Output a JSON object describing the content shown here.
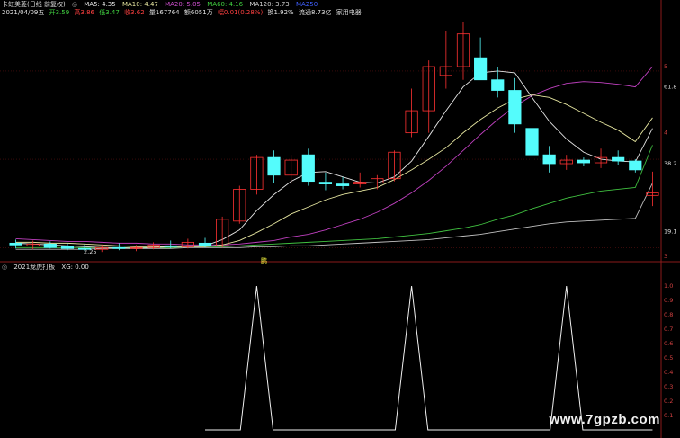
{
  "header": {
    "stock": "卡虹美菱(日线 前复权)",
    "ma5": "MA5: 4.35",
    "ma10": "MA10: 4.47",
    "ma20": "MA20: 5.05",
    "ma60": "MA60: 4.16",
    "ma120": "MA120: 3.73",
    "ma250": "MA250"
  },
  "info": {
    "date": "2021/04/09五",
    "open": "开3.59",
    "high": "高3.86",
    "low": "低3.47",
    "close": "收3.62",
    "volume": "量167764",
    "amount": "额6051万",
    "change": "幅0.01(0.28%)",
    "turnover": "换1.92%",
    "float": "流通8.73亿",
    "sector": "家用电器"
  },
  "indicator": {
    "name": "2021龙虎打板",
    "xg": "XG: 0.00"
  },
  "marker_label": "鹏",
  "low_label": "2.25",
  "price_axis": {
    "labels": [
      "5",
      "61.8",
      "4",
      "38.2",
      "19.1",
      "3"
    ]
  },
  "ind_axis": {
    "labels": [
      "1.0",
      "0.9",
      "0.8",
      "0.7",
      "0.6",
      "0.5",
      "0.4",
      "0.3",
      "0.2",
      "0.1"
    ]
  },
  "watermark": "www.7gpzb.com",
  "colors": {
    "up": "#ff3232",
    "down": "#54fcfc",
    "ma5": "#e6e6e6",
    "ma10": "#e6e6a0",
    "ma20": "#c040c0",
    "ma60": "#40c040",
    "ma120": "#c0c0c0",
    "ma250": "#4040ff"
  },
  "chart_data": {
    "type": "candlestick",
    "candles": [
      {
        "o": 3.05,
        "h": 3.09,
        "l": 2.99,
        "c": 3.03
      },
      {
        "o": 3.02,
        "h": 3.08,
        "l": 2.98,
        "c": 3.04
      },
      {
        "o": 3.04,
        "h": 3.07,
        "l": 2.99,
        "c": 3.0
      },
      {
        "o": 3.01,
        "h": 3.05,
        "l": 2.97,
        "c": 2.99
      },
      {
        "o": 2.99,
        "h": 3.04,
        "l": 2.96,
        "c": 2.98
      },
      {
        "o": 2.98,
        "h": 3.03,
        "l": 2.95,
        "c": 3.0
      },
      {
        "o": 3.0,
        "h": 3.05,
        "l": 2.97,
        "c": 2.99
      },
      {
        "o": 2.99,
        "h": 3.03,
        "l": 2.96,
        "c": 3.0
      },
      {
        "o": 3.0,
        "h": 3.06,
        "l": 2.98,
        "c": 3.03
      },
      {
        "o": 3.02,
        "h": 3.08,
        "l": 2.99,
        "c": 3.01
      },
      {
        "o": 3.01,
        "h": 3.1,
        "l": 2.99,
        "c": 3.06
      },
      {
        "o": 3.05,
        "h": 3.11,
        "l": 3.0,
        "c": 3.02
      },
      {
        "o": 3.02,
        "h": 3.35,
        "l": 3.0,
        "c": 3.32
      },
      {
        "o": 3.3,
        "h": 3.7,
        "l": 3.27,
        "c": 3.66
      },
      {
        "o": 3.66,
        "h": 4.05,
        "l": 3.6,
        "c": 4.02
      },
      {
        "o": 4.02,
        "h": 4.1,
        "l": 3.73,
        "c": 3.82
      },
      {
        "o": 3.82,
        "h": 4.05,
        "l": 3.72,
        "c": 3.99
      },
      {
        "o": 4.05,
        "h": 4.12,
        "l": 3.7,
        "c": 3.75
      },
      {
        "o": 3.74,
        "h": 3.85,
        "l": 3.65,
        "c": 3.72
      },
      {
        "o": 3.72,
        "h": 3.8,
        "l": 3.66,
        "c": 3.7
      },
      {
        "o": 3.72,
        "h": 3.85,
        "l": 3.68,
        "c": 3.74
      },
      {
        "o": 3.73,
        "h": 3.82,
        "l": 3.66,
        "c": 3.78
      },
      {
        "o": 3.78,
        "h": 4.1,
        "l": 3.75,
        "c": 4.08
      },
      {
        "o": 4.3,
        "h": 4.8,
        "l": 4.25,
        "c": 4.55
      },
      {
        "o": 4.55,
        "h": 5.12,
        "l": 4.3,
        "c": 5.05
      },
      {
        "o": 4.95,
        "h": 5.45,
        "l": 4.8,
        "c": 5.05
      },
      {
        "o": 5.05,
        "h": 5.55,
        "l": 4.9,
        "c": 5.42
      },
      {
        "o": 5.15,
        "h": 5.38,
        "l": 4.95,
        "c": 4.9
      },
      {
        "o": 4.9,
        "h": 5.05,
        "l": 4.7,
        "c": 4.78
      },
      {
        "o": 4.78,
        "h": 4.92,
        "l": 4.3,
        "c": 4.4
      },
      {
        "o": 4.35,
        "h": 4.45,
        "l": 4.0,
        "c": 4.05
      },
      {
        "o": 4.05,
        "h": 4.15,
        "l": 3.85,
        "c": 3.95
      },
      {
        "o": 3.95,
        "h": 4.05,
        "l": 3.88,
        "c": 3.99
      },
      {
        "o": 3.99,
        "h": 4.02,
        "l": 3.92,
        "c": 3.96
      },
      {
        "o": 3.96,
        "h": 4.12,
        "l": 3.9,
        "c": 4.02
      },
      {
        "o": 4.02,
        "h": 4.1,
        "l": 3.94,
        "c": 3.98
      },
      {
        "o": 3.98,
        "h": 4.0,
        "l": 3.85,
        "c": 3.88
      },
      {
        "o": 3.59,
        "h": 3.86,
        "l": 3.47,
        "c": 3.62
      }
    ],
    "skip_gaps": [
      31
    ],
    "y_range": [
      2.85,
      5.6
    ],
    "ma5": [
      3.05,
      3.04,
      3.03,
      3.02,
      3.01,
      3.0,
      3.0,
      2.99,
      3.0,
      3.01,
      3.02,
      3.02,
      3.09,
      3.2,
      3.42,
      3.6,
      3.75,
      3.85,
      3.86,
      3.8,
      3.74,
      3.73,
      3.8,
      3.98,
      4.26,
      4.55,
      4.82,
      4.98,
      5.0,
      4.98,
      4.7,
      4.43,
      4.23,
      4.08,
      4.0,
      3.98,
      3.97,
      4.35
    ],
    "ma10": [
      3.06,
      3.06,
      3.05,
      3.05,
      3.04,
      3.03,
      3.02,
      3.01,
      3.01,
      3.01,
      3.01,
      3.01,
      3.03,
      3.08,
      3.17,
      3.27,
      3.38,
      3.46,
      3.54,
      3.6,
      3.64,
      3.68,
      3.77,
      3.88,
      4.0,
      4.13,
      4.3,
      4.45,
      4.58,
      4.68,
      4.73,
      4.7,
      4.62,
      4.52,
      4.42,
      4.33,
      4.2,
      4.47
    ],
    "ma20": [
      3.1,
      3.09,
      3.08,
      3.07,
      3.07,
      3.06,
      3.05,
      3.05,
      3.04,
      3.04,
      3.03,
      3.03,
      3.03,
      3.04,
      3.06,
      3.08,
      3.12,
      3.15,
      3.2,
      3.26,
      3.32,
      3.4,
      3.5,
      3.62,
      3.76,
      3.92,
      4.1,
      4.28,
      4.45,
      4.6,
      4.72,
      4.8,
      4.86,
      4.88,
      4.87,
      4.85,
      4.82,
      5.05
    ],
    "ma60": [
      3.0,
      3.0,
      3.0,
      3.0,
      3.0,
      3.0,
      3.0,
      3.0,
      3.0,
      3.0,
      3.01,
      3.01,
      3.01,
      3.02,
      3.03,
      3.04,
      3.05,
      3.06,
      3.07,
      3.08,
      3.09,
      3.1,
      3.12,
      3.14,
      3.16,
      3.19,
      3.22,
      3.26,
      3.32,
      3.37,
      3.44,
      3.5,
      3.56,
      3.6,
      3.64,
      3.66,
      3.68,
      4.16
    ],
    "ma120": [
      2.98,
      2.98,
      2.98,
      2.98,
      2.98,
      2.99,
      2.99,
      2.99,
      2.99,
      2.99,
      3.0,
      3.0,
      3.0,
      3.0,
      3.01,
      3.01,
      3.02,
      3.02,
      3.03,
      3.04,
      3.05,
      3.06,
      3.07,
      3.08,
      3.09,
      3.11,
      3.13,
      3.15,
      3.18,
      3.21,
      3.24,
      3.27,
      3.29,
      3.3,
      3.31,
      3.32,
      3.33,
      3.73
    ],
    "indicator": {
      "values": [
        0,
        0,
        0,
        0,
        0,
        0,
        0,
        0,
        0,
        0,
        0,
        0,
        0,
        0,
        1,
        0,
        0,
        0,
        0,
        0,
        0,
        0,
        0,
        1,
        0,
        0,
        0,
        0,
        0,
        0,
        0,
        0,
        1,
        0,
        0,
        0,
        0,
        0
      ],
      "ylim": [
        0,
        1.1
      ]
    }
  }
}
